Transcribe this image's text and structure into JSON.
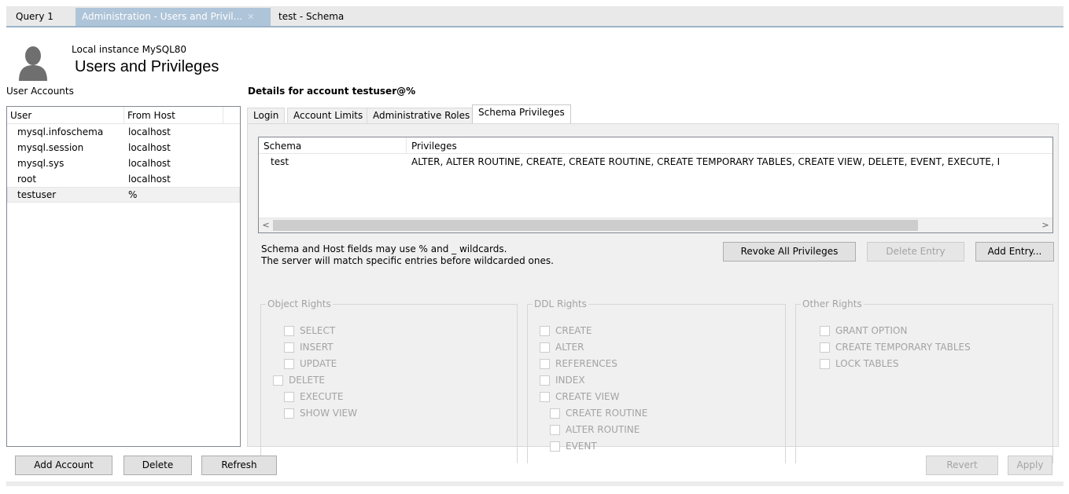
{
  "tabs": [
    {
      "label": "Query 1"
    },
    {
      "label": "Administration - Users and Privil..."
    },
    {
      "label": "test - Schema"
    }
  ],
  "header": {
    "instance": "Local instance MySQL80",
    "title": "Users and Privileges"
  },
  "user_accounts": {
    "label": "User Accounts",
    "columns": [
      "User",
      "From Host"
    ],
    "rows": [
      {
        "user": "mysql.infoschema",
        "host": "localhost"
      },
      {
        "user": "mysql.session",
        "host": "localhost"
      },
      {
        "user": "mysql.sys",
        "host": "localhost"
      },
      {
        "user": "root",
        "host": "localhost"
      },
      {
        "user": "testuser",
        "host": "%"
      }
    ]
  },
  "details": {
    "label": "Details for account testuser@%",
    "tabs": [
      "Login",
      "Account Limits",
      "Administrative Roles",
      "Schema Privileges"
    ]
  },
  "schema_table": {
    "columns": [
      "Schema",
      "Privileges"
    ],
    "rows": [
      {
        "schema": "test",
        "privileges": "ALTER, ALTER ROUTINE, CREATE, CREATE ROUTINE, CREATE TEMPORARY TABLES, CREATE VIEW, DELETE, EVENT, EXECUTE, I"
      }
    ]
  },
  "help": {
    "line1": "Schema and Host fields may use % and _ wildcards.",
    "line2": "The server will match specific entries before wildcarded ones."
  },
  "buttons": {
    "revoke_all": "Revoke All Privileges",
    "delete_entry": "Delete Entry",
    "add_entry": "Add Entry...",
    "add_account": "Add Account",
    "delete": "Delete",
    "refresh": "Refresh",
    "revert": "Revert",
    "apply": "Apply"
  },
  "object_rights": {
    "legend": "Object Rights",
    "items": [
      "SELECT",
      "INSERT",
      "UPDATE",
      "DELETE",
      "EXECUTE",
      "SHOW VIEW"
    ]
  },
  "ddl_rights": {
    "legend": "DDL Rights",
    "items": [
      "CREATE",
      "ALTER",
      "REFERENCES",
      "INDEX",
      "CREATE VIEW",
      "CREATE ROUTINE",
      "ALTER ROUTINE",
      "EVENT"
    ]
  },
  "other_rights": {
    "legend": "Other Rights",
    "items": [
      "GRANT OPTION",
      "CREATE TEMPORARY TABLES",
      "LOCK TABLES"
    ]
  }
}
